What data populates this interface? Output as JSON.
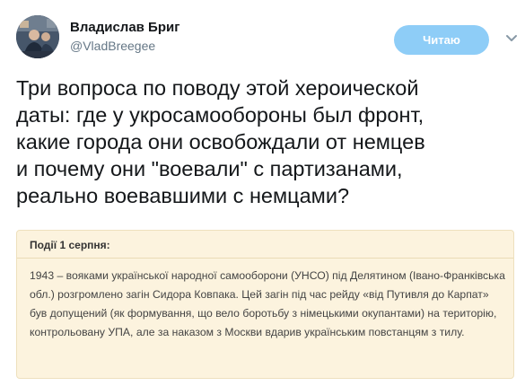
{
  "author": {
    "name": "Владислав Бриг",
    "handle": "@VladBreegee",
    "avatar_icon": "user-avatar"
  },
  "follow_button": {
    "label": "Читаю",
    "color": "#8ecdf7"
  },
  "menu_icon": "chevron-down-icon",
  "tweet": {
    "text": "Три вопроса по поводу этой хероической\nдаты: где у укросамообороны был фронт,\nкакие города они освобождали от немцев\nи почему они \"воевали\" с партизанами,\nреально воевавшими с немцами?"
  },
  "quote_card": {
    "header": "Події 1 серпня:",
    "body": "1943 – вояками української народної самооборони (УНСО) під Делятином (Івано-Франківська обл.) розгромлено загін Сидора Ковпака. Цей загін під час рейду «від Путивля до Карпат» був допущений (як формування, що вело боротьбу з німецькими окупантами) на територію, контрольовану УПА, але за наказом з Москви вдарив українським повстанцям з тилу.",
    "background": "#fcf3de"
  }
}
